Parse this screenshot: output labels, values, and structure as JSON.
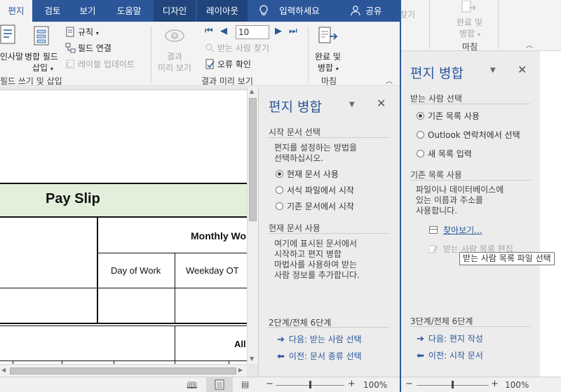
{
  "tabs": [
    {
      "label": "편지",
      "active": true
    },
    {
      "label": "검토"
    },
    {
      "label": "보기"
    },
    {
      "label": "도움말"
    },
    {
      "label": "디자인",
      "contextual": true
    },
    {
      "label": "레이아웃",
      "contextual": true
    }
  ],
  "tell_me": "입력하세요",
  "share": "공유",
  "ribbon": {
    "insert_merge_field_l1": "병합 필드",
    "insert_merge_field_l2": "삽입",
    "greeting_line_partial": "인사말",
    "rules": "규칙",
    "match_fields": "필드 연결",
    "update_labels": "레이블 업데이트",
    "group_write_insert": "필드 쓰기 및 삽입",
    "preview_results_l1": "결과",
    "preview_results_l2": "미리 보기",
    "record_number": "10",
    "find_recipient": "받는 사람 찾기",
    "check_errors": "오류 확인",
    "group_preview": "결과 미리 보기",
    "finish_merge_l1": "완료 및",
    "finish_merge_l2": "병합",
    "group_finish": "마침"
  },
  "right_ribbon": {
    "partial_label": "찾기",
    "finish_merge_l1": "완료 및",
    "finish_merge_l2": "병합",
    "group_finish": "마침"
  },
  "document": {
    "title": "Pay Slip",
    "monthly": "Monthly Wo",
    "day_of_work": "Day of Work",
    "weekday_ot": "Weekday OT",
    "all_partial": "All"
  },
  "pane1": {
    "title": "편지 병합",
    "section1": "시작 문서 선택",
    "desc1_l1": "편지를 설정하는 방법을",
    "desc1_l2": "선택하십시오.",
    "options": [
      {
        "label": "현재 문서 사용",
        "selected": true
      },
      {
        "label": "서식 파일에서 시작",
        "selected": false
      },
      {
        "label": "기존 문서에서 시작",
        "selected": false
      }
    ],
    "section2": "현재 문서 사용",
    "desc2": [
      "여기에 표시된 문서에서",
      "시작하고 편지 병합",
      "마법사를 사용하여 받는",
      "사람 정보를 추가합니다."
    ],
    "step": "2단계/전체 6단계",
    "next": "다음: 받는 사람 선택",
    "prev": "이전: 문서 종류 선택"
  },
  "pane2": {
    "title": "편지 병합",
    "section1": "받는 사람 선택",
    "options": [
      {
        "label": "기존 목록 사용",
        "selected": true
      },
      {
        "label": "Outlook 연락처에서 선택",
        "selected": false
      },
      {
        "label": "새 목록 입력",
        "selected": false
      }
    ],
    "section2": "기존 목록 사용",
    "desc": [
      "파일이나 데이터베이스에",
      "있는 이름과 주소를",
      "사용합니다."
    ],
    "browse": "찾아보기...",
    "edit_list": "받는 사람 목록 편집",
    "step": "3단계/전체 6단계",
    "next": "다음: 편지 작성",
    "prev": "이전: 시작 문서"
  },
  "tooltip": "받는 사람 목록 파일 선택",
  "status": {
    "zoom_left": "100%",
    "zoom_right": "100%",
    "minus": "−",
    "plus": "+"
  },
  "colors": {
    "accent": "#2b579a",
    "header_fill": "#e2efda"
  }
}
